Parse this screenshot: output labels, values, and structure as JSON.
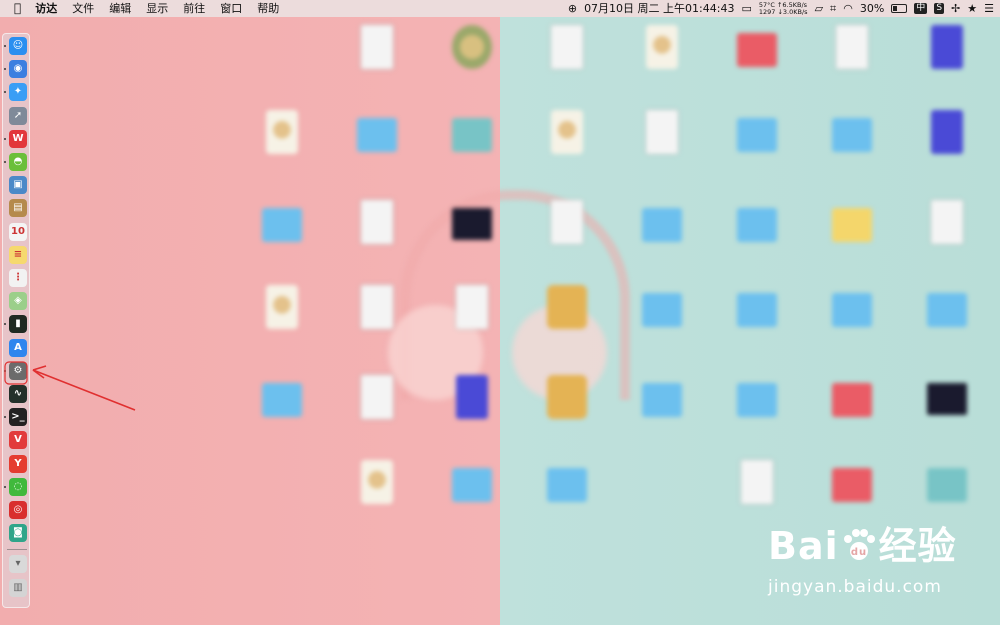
{
  "menubar": {
    "apple": "",
    "menus": [
      "访达",
      "文件",
      "编辑",
      "显示",
      "前往",
      "窗口",
      "帮助"
    ],
    "datetime": "07月10日 周二 上午01:44:43",
    "sensor_top": "57°C ↑6.5KB/s",
    "sensor_bottom": "1297 ↓3.0KB/s",
    "battery": "30%",
    "input_method": "中"
  },
  "watermark": {
    "logo_left": "Bai",
    "logo_right": "经验",
    "url": "jingyan.baidu.com"
  },
  "dock": {
    "items": [
      {
        "icon": "finder-icon",
        "color": "#2a8ff0",
        "glyph": "☺"
      },
      {
        "icon": "siri-icon",
        "color": "#3b7fe0",
        "glyph": "◉"
      },
      {
        "icon": "safari-icon",
        "color": "#3a9ef5",
        "glyph": "✦"
      },
      {
        "icon": "launchpad-icon",
        "color": "#7f8a99",
        "glyph": "➚"
      },
      {
        "icon": "wps-icon",
        "color": "#e2363b",
        "glyph": "W"
      },
      {
        "icon": "android-icon",
        "color": "#6bbf3a",
        "glyph": "◓"
      },
      {
        "icon": "preview-icon",
        "color": "#4b89c8",
        "glyph": "▣"
      },
      {
        "icon": "notebook-icon",
        "color": "#b58a4c",
        "glyph": "▤"
      },
      {
        "icon": "calendar-icon",
        "color": "#f4f4f4",
        "glyph": "10"
      },
      {
        "icon": "notes-icon",
        "color": "#f6d96e",
        "glyph": "≡"
      },
      {
        "icon": "reminders-icon",
        "color": "#f2f2f2",
        "glyph": "⋮"
      },
      {
        "icon": "maps-icon",
        "color": "#9bcf8a",
        "glyph": "◈"
      },
      {
        "icon": "activity-monitor-icon",
        "color": "#1f2a22",
        "glyph": "▮"
      },
      {
        "icon": "app-store-icon",
        "color": "#2e86ee",
        "glyph": "A"
      },
      {
        "icon": "system-preferences-icon",
        "color": "#6b6b6b",
        "glyph": "⚙"
      },
      {
        "icon": "console-icon",
        "color": "#23302a",
        "glyph": "∿"
      },
      {
        "icon": "terminal-icon",
        "color": "#222222",
        "glyph": ">_"
      },
      {
        "icon": "vivaldi-icon",
        "color": "#e23b3b",
        "glyph": "V"
      },
      {
        "icon": "yandex-browser-icon",
        "color": "#e53c30",
        "glyph": "Y"
      },
      {
        "icon": "wechat-icon",
        "color": "#40b93c",
        "glyph": "◌"
      },
      {
        "icon": "netease-music-icon",
        "color": "#d92e2e",
        "glyph": "◎"
      },
      {
        "icon": "screen-capture-icon",
        "color": "#2fa58a",
        "glyph": "◙"
      }
    ],
    "trailing": [
      {
        "icon": "downloads-stack-icon",
        "color": "#d9d9d9",
        "glyph": "▾"
      },
      {
        "icon": "trash-icon",
        "color": "#d4d4d4",
        "glyph": "▥"
      }
    ]
  },
  "desktop": {
    "icons": [
      {
        "type": "doc",
        "caption": ""
      },
      {
        "type": "cartoon",
        "caption": ""
      },
      {
        "type": "doc",
        "caption": ""
      },
      {
        "type": "pkg",
        "caption": ""
      },
      {
        "type": "folder-r",
        "caption": ""
      },
      {
        "type": "doc",
        "caption": ""
      },
      {
        "type": "vid",
        "caption": ""
      },
      {
        "type": "pkg",
        "caption": ""
      },
      {
        "type": "folder",
        "caption": ""
      },
      {
        "type": "teal",
        "caption": ""
      },
      {
        "type": "pkg",
        "caption": ""
      },
      {
        "type": "doc",
        "caption": ""
      },
      {
        "type": "folder",
        "caption": ""
      },
      {
        "type": "folder",
        "caption": ""
      },
      {
        "type": "vid",
        "caption": ""
      },
      {
        "type": "folder",
        "caption": ""
      },
      {
        "type": "doc",
        "caption": ""
      },
      {
        "type": "dark",
        "caption": ""
      },
      {
        "type": "doc",
        "caption": ""
      },
      {
        "type": "folder",
        "caption": ""
      },
      {
        "type": "folder",
        "caption": ""
      },
      {
        "type": "folder-y",
        "caption": ""
      },
      {
        "type": "doc",
        "caption": ""
      },
      {
        "type": "pkg",
        "caption": ""
      },
      {
        "type": "doc",
        "caption": ""
      },
      {
        "type": "doc",
        "caption": ""
      },
      {
        "type": "gold",
        "caption": ""
      },
      {
        "type": "folder",
        "caption": ""
      },
      {
        "type": "folder",
        "caption": ""
      },
      {
        "type": "folder",
        "caption": ""
      },
      {
        "type": "folder",
        "caption": ""
      },
      {
        "type": "folder",
        "caption": ""
      },
      {
        "type": "doc",
        "caption": ""
      },
      {
        "type": "vid",
        "caption": ""
      },
      {
        "type": "gold",
        "caption": ""
      },
      {
        "type": "folder",
        "caption": ""
      },
      {
        "type": "folder",
        "caption": ""
      },
      {
        "type": "folder-r",
        "caption": ""
      },
      {
        "type": "dark",
        "caption": ""
      },
      {
        "type": "pkg",
        "caption": ""
      },
      {
        "type": "folder",
        "caption": ""
      },
      {
        "type": "folder",
        "caption": ""
      },
      {
        "type": "doc",
        "caption": ""
      },
      {
        "type": "folder-r",
        "caption": ""
      },
      {
        "type": "teal",
        "caption": ""
      }
    ]
  }
}
